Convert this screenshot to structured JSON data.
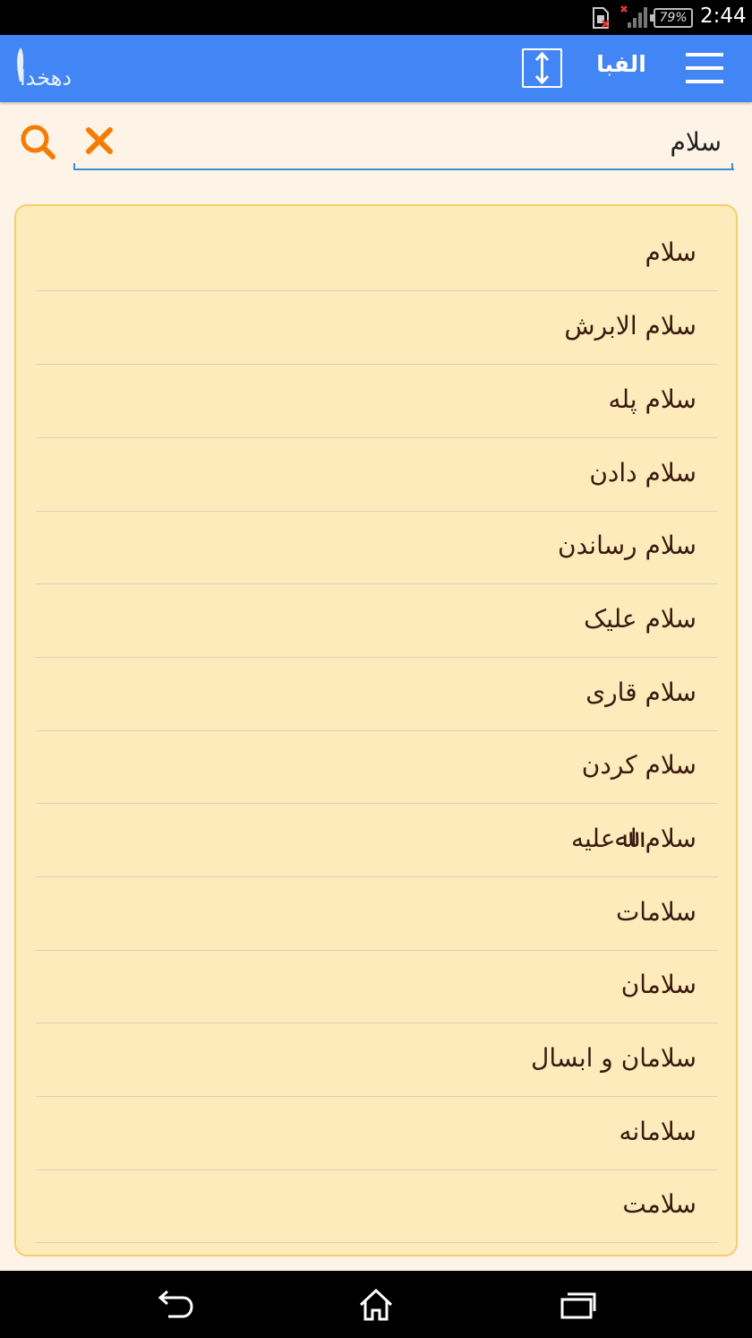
{
  "status_bar": {
    "battery": "79%",
    "time": "2:44",
    "icons": [
      "sim-missing-icon",
      "signal-icon",
      "battery-icon"
    ]
  },
  "app_bar": {
    "logo_text": "دهخدا",
    "mode_label": "الفبا",
    "icons": [
      "logo-icon",
      "sort-order-icon",
      "menu-icon"
    ]
  },
  "search": {
    "value": "سلام",
    "placeholder": "",
    "accent_color": "#f57c00",
    "icons": [
      "search-icon",
      "clear-icon"
    ]
  },
  "results": [
    "سلام",
    "سلام الابرش",
    "سلام پله",
    "سلام دادن",
    "سلام رساندن",
    "سلام علیک",
    "سلام قاری",
    "سلام کردن",
    "سلام اﷲعلیه",
    "سلامات",
    "سلامان",
    "سلامان و ابسال",
    "سلامانه",
    "سلامت"
  ],
  "nav_bar": {
    "icons": [
      "back-icon",
      "home-icon",
      "recents-icon"
    ]
  },
  "colors": {
    "app_bar": "#4285f4",
    "background": "#fdf3e6",
    "card": "#fdebbb",
    "card_border": "#f7cf6a",
    "text": "#3a1a10"
  }
}
